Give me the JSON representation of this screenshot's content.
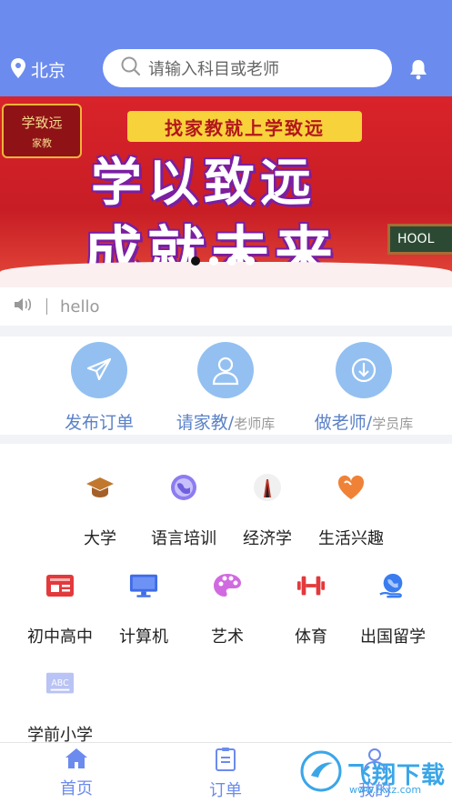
{
  "header": {
    "location": "北京",
    "search_placeholder": "请输入科目或老师"
  },
  "banner": {
    "slogan": "找家教就上学致远",
    "line1": "学以致远",
    "line2": "成就未来",
    "logo_title": "学致远",
    "logo_sub": "家教",
    "board_text": "HOOL",
    "slide_count": 4,
    "active_slide": 1
  },
  "notice": {
    "text": "hello"
  },
  "quick_actions": [
    {
      "label": "发布订单",
      "sub": ""
    },
    {
      "label": "请家教/",
      "sub": "老师库"
    },
    {
      "label": "做老师/",
      "sub": "学员库"
    }
  ],
  "categories": [
    {
      "label": "大学",
      "icon": "graduation-cap-icon"
    },
    {
      "label": "语言培训",
      "icon": "globe-icon"
    },
    {
      "label": "经济学",
      "icon": "metronome-icon"
    },
    {
      "label": "生活兴趣",
      "icon": "heart-icon"
    },
    {
      "label": "初中高中",
      "icon": "id-card-icon"
    },
    {
      "label": "计算机",
      "icon": "monitor-icon"
    },
    {
      "label": "艺术",
      "icon": "palette-icon"
    },
    {
      "label": "体育",
      "icon": "dumbbell-icon"
    },
    {
      "label": "出国留学",
      "icon": "globe-hand-icon"
    },
    {
      "label": "学前小学",
      "icon": "abc-icon"
    }
  ],
  "tabbar": [
    {
      "label": "首页",
      "icon": "home-icon"
    },
    {
      "label": "订单",
      "icon": "clipboard-icon"
    },
    {
      "label": "我的",
      "icon": "user-icon"
    }
  ],
  "watermark": {
    "text": "飞翔下载",
    "sub": "www.fxxz.com"
  },
  "colors": {
    "primary": "#6b8bee",
    "quick_circle": "#93c0f1",
    "banner_red": "#d9232a"
  }
}
